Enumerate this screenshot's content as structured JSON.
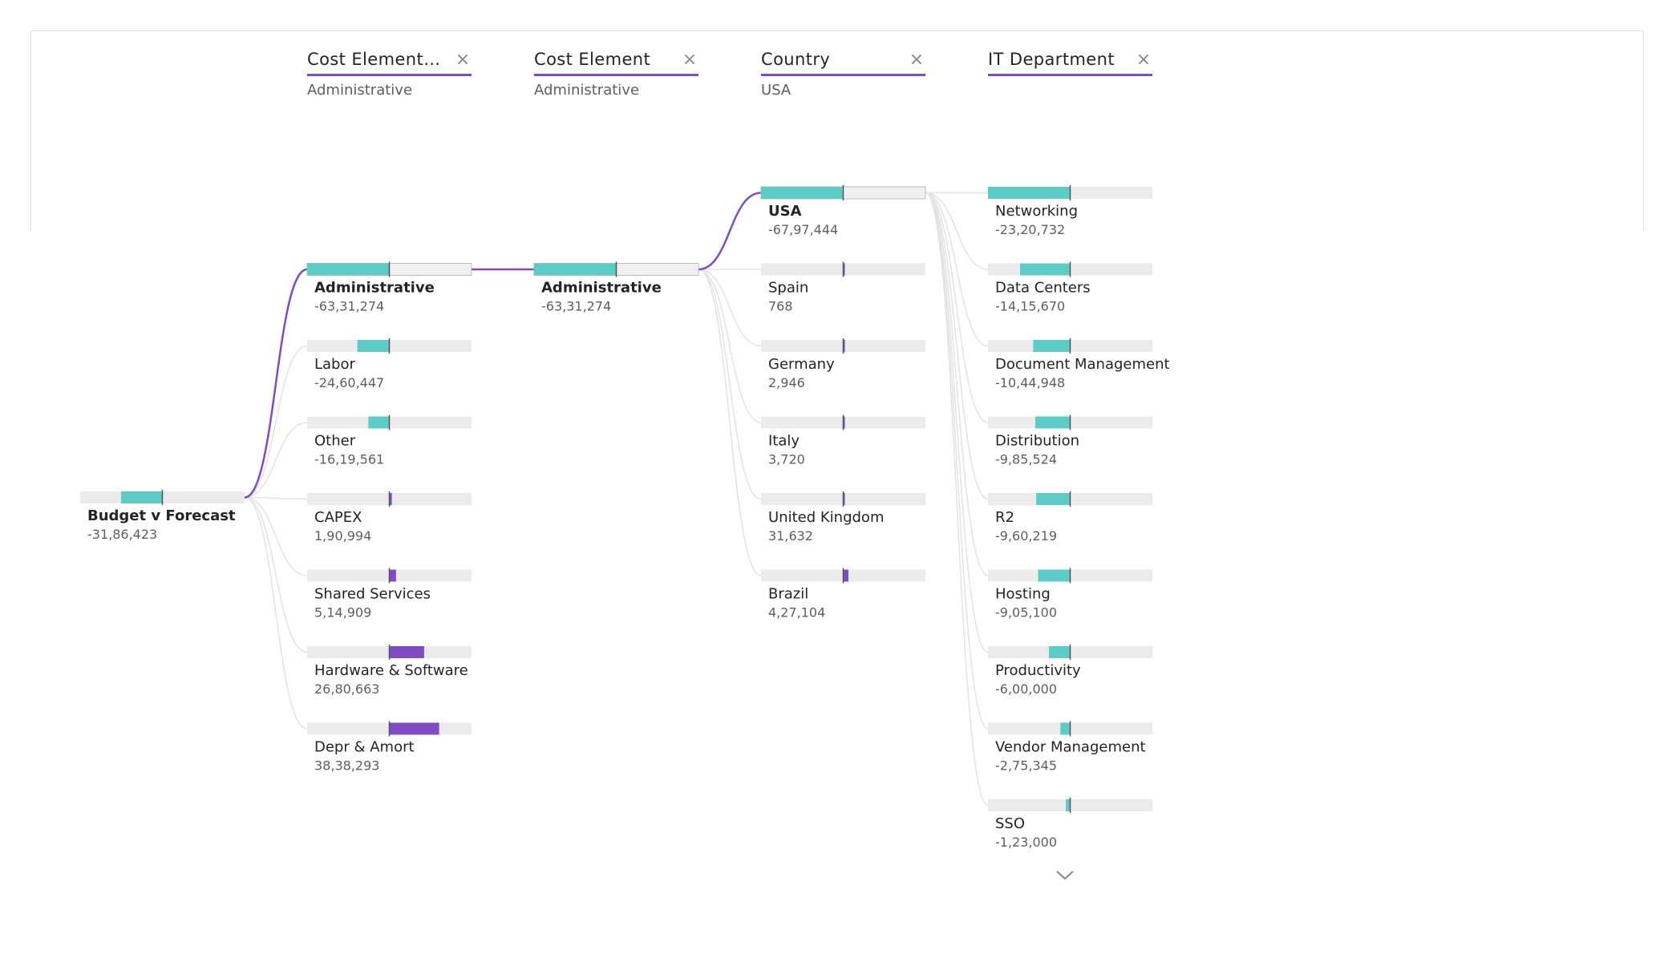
{
  "colors": {
    "negative": "#5fcbc7",
    "positive": "#7f4cc4",
    "track": "#ebebeb",
    "selected_path": "#7f4cc4",
    "connector": "#e3e3e3"
  },
  "levels": [
    {
      "title": "Cost Element Gr...",
      "selected": "Administrative",
      "close_icon": "close-icon"
    },
    {
      "title": "Cost Element",
      "selected": "Administrative",
      "close_icon": "close-icon"
    },
    {
      "title": "Country",
      "selected": "USA",
      "close_icon": "close-icon"
    },
    {
      "title": "IT Department",
      "selected": "",
      "close_icon": "close-icon"
    }
  ],
  "root": {
    "name": "Budget v Forecast",
    "value_label": "-31,86,423",
    "value": -3186423
  },
  "columns": [
    {
      "max": 6331274,
      "nodes": [
        {
          "name": "Administrative",
          "value_label": "-63,31,274",
          "value": -6331274,
          "selected": true
        },
        {
          "name": "Labor",
          "value_label": "-24,60,447",
          "value": -2460447
        },
        {
          "name": "Other",
          "value_label": "-16,19,561",
          "value": -1619561
        },
        {
          "name": "CAPEX",
          "value_label": "1,90,994",
          "value": 190994
        },
        {
          "name": "Shared Services",
          "value_label": "5,14,909",
          "value": 514909
        },
        {
          "name": "Hardware & Software",
          "value_label": "26,80,663",
          "value": 2680663
        },
        {
          "name": "Depr & Amort",
          "value_label": "38,38,293",
          "value": 3838293
        }
      ]
    },
    {
      "max": 6331274,
      "nodes": [
        {
          "name": "Administrative",
          "value_label": "-63,31,274",
          "value": -6331274,
          "selected": true
        }
      ]
    },
    {
      "max": 6797444,
      "nodes": [
        {
          "name": "USA",
          "value_label": "-67,97,444",
          "value": -6797444,
          "selected": true
        },
        {
          "name": "Spain",
          "value_label": "768",
          "value": 768
        },
        {
          "name": "Germany",
          "value_label": "2,946",
          "value": 2946
        },
        {
          "name": "Italy",
          "value_label": "3,720",
          "value": 3720
        },
        {
          "name": "United Kingdom",
          "value_label": "31,632",
          "value": 31632
        },
        {
          "name": "Brazil",
          "value_label": "4,27,104",
          "value": 427104
        }
      ]
    },
    {
      "max": 2320732,
      "nodes": [
        {
          "name": "Networking",
          "value_label": "-23,20,732",
          "value": -2320732
        },
        {
          "name": "Data Centers",
          "value_label": "-14,15,670",
          "value": -1415670
        },
        {
          "name": "Document Management",
          "value_label": "-10,44,948",
          "value": -1044948
        },
        {
          "name": "Distribution",
          "value_label": "-9,85,524",
          "value": -985524
        },
        {
          "name": "R2",
          "value_label": "-9,60,219",
          "value": -960219
        },
        {
          "name": "Hosting",
          "value_label": "-9,05,100",
          "value": -905100
        },
        {
          "name": "Productivity",
          "value_label": "-6,00,000",
          "value": -600000
        },
        {
          "name": "Vendor Management",
          "value_label": "-2,75,345",
          "value": -275345
        },
        {
          "name": "SSO",
          "value_label": "-1,23,000",
          "value": -123000
        }
      ]
    }
  ],
  "expand_icon": "chevron-down-icon"
}
